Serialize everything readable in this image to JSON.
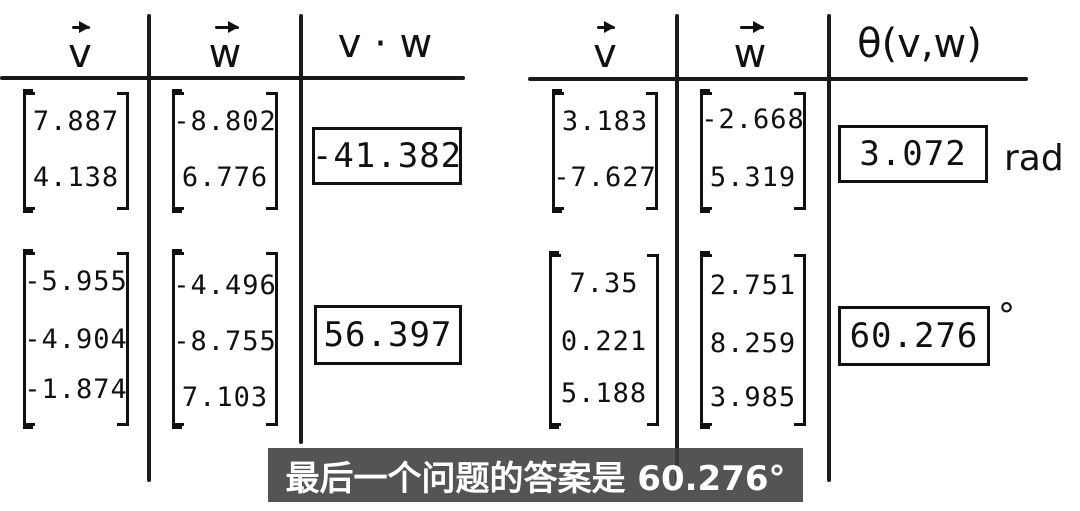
{
  "left_table": {
    "headers": [
      "v",
      "w",
      "v · w"
    ],
    "rows": [
      {
        "v": [
          "7.887",
          "4.138"
        ],
        "w": [
          "-8.802",
          "6.776"
        ],
        "result": "-41.382"
      },
      {
        "v": [
          "-5.955",
          "-4.904",
          "-1.874"
        ],
        "w": [
          "-4.496",
          "-8.755",
          "7.103"
        ],
        "result": "56.397"
      }
    ]
  },
  "right_table": {
    "headers": [
      "v",
      "w",
      "θ(v,w)"
    ],
    "rows": [
      {
        "v": [
          "3.183",
          "-7.627"
        ],
        "w": [
          "-2.668",
          "5.319"
        ],
        "result": "3.072",
        "unit": "rad"
      },
      {
        "v": [
          "7.35",
          "0.221",
          "5.188"
        ],
        "w": [
          "2.751",
          "8.259",
          "3.985"
        ],
        "result": "60.276",
        "unit": "°"
      }
    ]
  },
  "subtitle": "最后一个问题的答案是 60.276°"
}
